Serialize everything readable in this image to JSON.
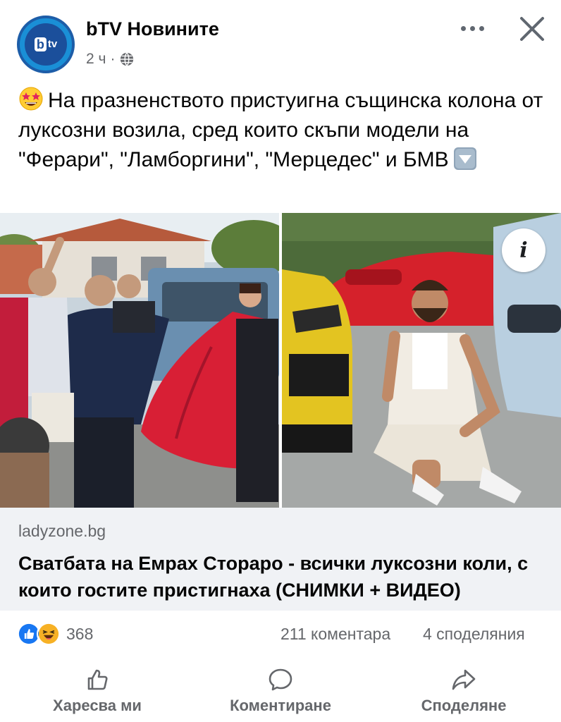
{
  "post": {
    "page_name": "bTV Новините",
    "time": "2 ч",
    "time_separator": "·",
    "avatar_letter": "b",
    "avatar_text": "tv",
    "text": "На празненството пристуигна същинска колона от луксозни возила, сред които скъпи модели на \"Ферари\", \"Ламборгини\", \"Мерцедес\" и БМВ",
    "leading_emoji": "star-struck-emoji",
    "trailing_emoji": "down-arrow-emoji"
  },
  "media": {
    "info_label": "i"
  },
  "link": {
    "domain": "ladyzone.bg",
    "title": "Сватбата на Емрах Стораро - всички луксозни коли, с които гостите пристигнаха (СНИМКИ + ВИДЕО)"
  },
  "stats": {
    "reactions_count": "368",
    "comments": "211 коментара",
    "shares": "4 споделяния",
    "reaction_icons": [
      "like-icon",
      "haha-icon"
    ]
  },
  "actions": {
    "like": "Харесва ми",
    "comment": "Коментиране",
    "share": "Споделяне"
  },
  "colors": {
    "secondary_text": "#65676b",
    "link_card_bg": "#f0f2f5",
    "brand_blue": "#1b4f9b",
    "like_blue": "#1877f2"
  }
}
